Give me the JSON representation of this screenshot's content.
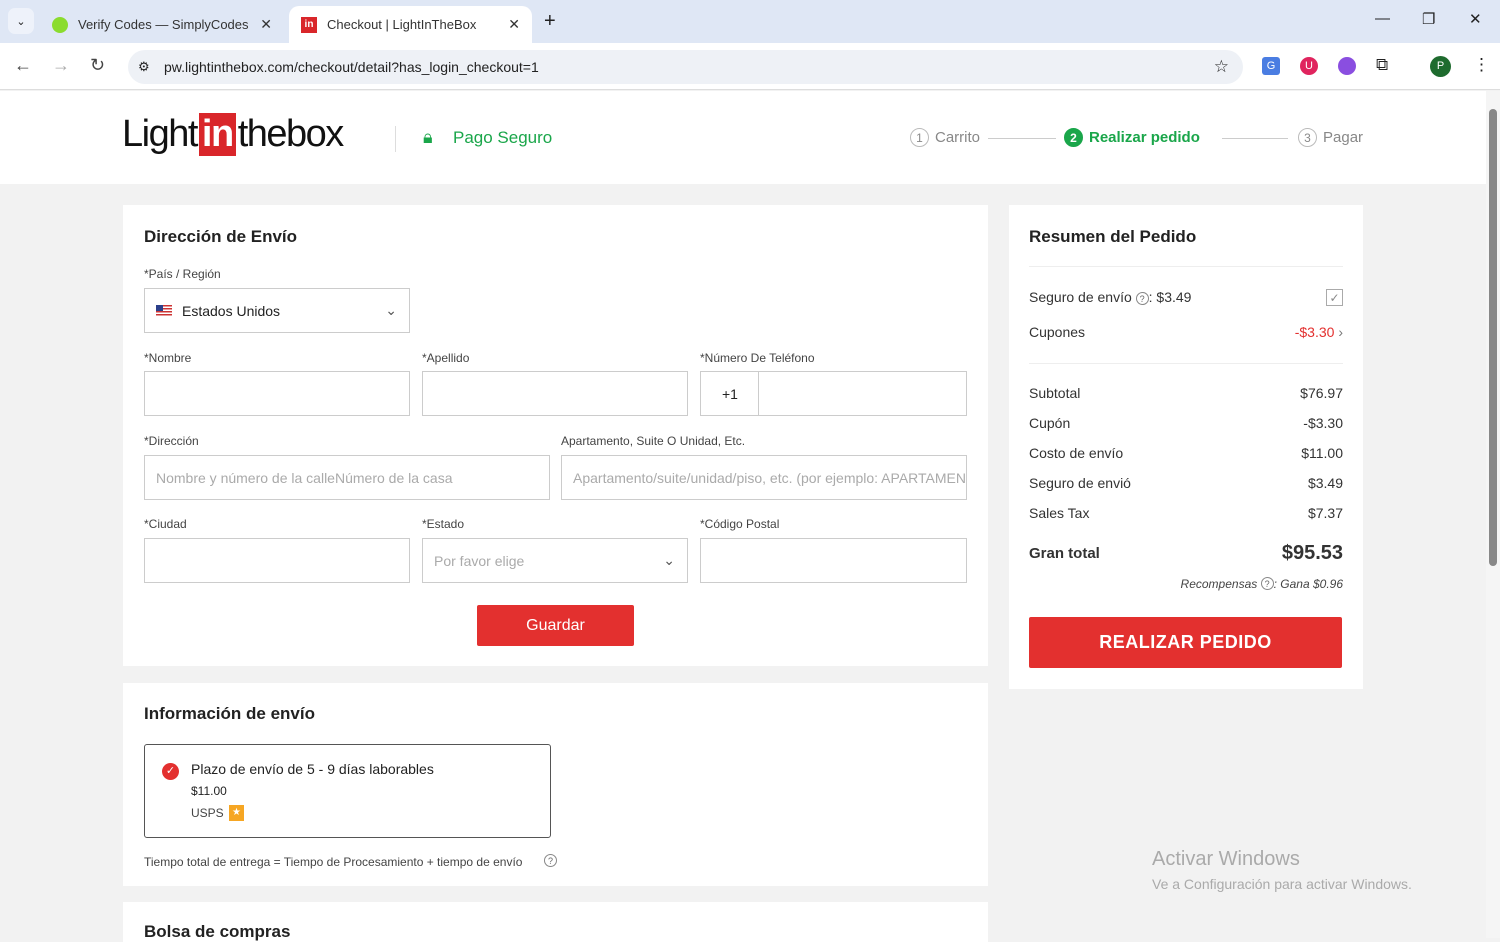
{
  "browser": {
    "tabs": [
      {
        "title": "Verify Codes — SimplyCodes"
      },
      {
        "title": "Checkout | LightInTheBox"
      }
    ],
    "url": "pw.lightinthebox.com/checkout/detail?has_login_checkout=1",
    "profile_initial": "P"
  },
  "header": {
    "logo_text": "Lightinthebox",
    "secure": "Pago Seguro",
    "steps": [
      {
        "num": "1",
        "label": "Carrito"
      },
      {
        "num": "2",
        "label": "Realizar pedido"
      },
      {
        "num": "3",
        "label": "Pagar"
      }
    ]
  },
  "address": {
    "title": "Dirección de Envío",
    "country_label": "*País / Región",
    "country_value": "Estados Unidos",
    "first_name_label": "*Nombre",
    "last_name_label": "*Apellido",
    "phone_label": "*Número De Teléfono",
    "phone_prefix": "+1",
    "address_label": "*Dirección",
    "address_placeholder": "Nombre y número de la calleNúmero de la casa",
    "apt_label": "Apartamento, Suite O Unidad, Etc.",
    "apt_placeholder": "Apartamento/suite/unidad/piso, etc. (por ejemplo: APARTAMENTO",
    "city_label": "*Ciudad",
    "state_label": "*Estado",
    "state_placeholder": "Por favor elige",
    "zip_label": "*Código Postal",
    "save": "Guardar"
  },
  "shipping": {
    "title": "Información de envío",
    "option_title": "Plazo de envío de 5 - 9 días laborables",
    "option_price": "$11.00",
    "carrier": "USPS",
    "note": "Tiempo total de entrega = Tiempo de Procesamiento + tiempo de envío"
  },
  "bag": {
    "title": "Bolsa de compras"
  },
  "summary": {
    "title": "Resumen del Pedido",
    "insurance": "Seguro de envío",
    "insurance_price": ": $3.49",
    "coupons": "Cupones",
    "coupons_value": "-$3.30",
    "rows": [
      {
        "label": "Subtotal",
        "value": "$76.97"
      },
      {
        "label": "Cupón",
        "value": "-$3.30"
      },
      {
        "label": "Costo de envío",
        "value": "$11.00"
      },
      {
        "label": "Seguro de envió",
        "value": "$3.49"
      },
      {
        "label": "Sales Tax",
        "value": "$7.37"
      }
    ],
    "total_label": "Gran total",
    "total_value": "$95.53",
    "rewards": "Recompensas",
    "rewards_value": ": Gana $0.96",
    "place_order": "REALIZAR PEDIDO"
  },
  "watermark": {
    "title": "Activar Windows",
    "subtitle": "Ve a Configuración para activar Windows."
  }
}
